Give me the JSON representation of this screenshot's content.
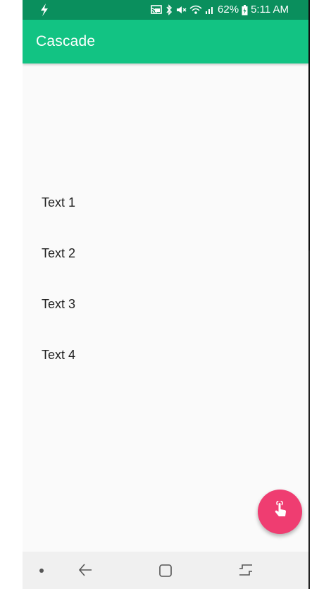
{
  "status_bar": {
    "battery_percent": "62%",
    "time": "5:11 AM",
    "icons": [
      "flash-icon",
      "cast-icon",
      "bluetooth-icon",
      "mute-icon",
      "wifi-icon",
      "signal-icon",
      "battery-icon"
    ]
  },
  "app_bar": {
    "title": "Cascade"
  },
  "list": {
    "items": [
      "Text 1",
      "Text 2",
      "Text 3",
      "Text 4"
    ]
  },
  "fab": {
    "icon": "touch-icon",
    "color": "#ef3d71"
  },
  "nav_bar": {
    "icons": [
      "nav-dot-icon",
      "back-icon",
      "home-icon",
      "recents-icon"
    ]
  },
  "colors": {
    "primary": "#12c383",
    "primary_dark": "#0a8f5d",
    "accent": "#ef3d71",
    "background": "#fafafa"
  }
}
